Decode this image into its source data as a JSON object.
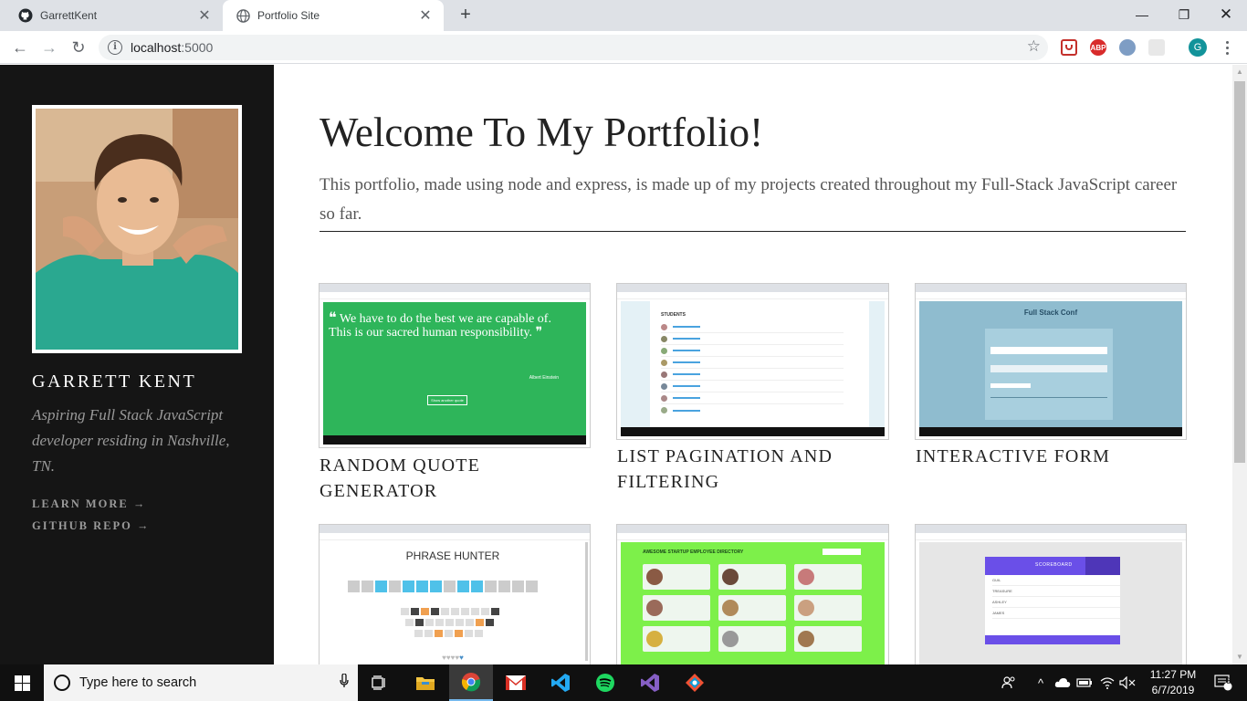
{
  "browser": {
    "tabs": [
      {
        "title": "GarrettKent",
        "active": false
      },
      {
        "title": "Portfolio Site",
        "active": true
      }
    ],
    "address": {
      "host": "localhost",
      "port": ":5000"
    },
    "profile_initial": "G",
    "extensions": [
      "ABP"
    ]
  },
  "sidebar": {
    "name": "GARRETT KENT",
    "tagline": "Aspiring Full Stack JavaScript developer residing in Nashville, TN.",
    "links": [
      {
        "label": "LEARN MORE →"
      },
      {
        "label": "GITHUB REPO →"
      }
    ]
  },
  "main": {
    "heading": "Welcome To My Portfolio!",
    "intro": "This portfolio, made using node and express, is made up of my projects created throughout my Full-Stack JavaScript career so far.",
    "projects": [
      {
        "title": "RANDOM QUOTE GENERATOR",
        "thumb_quote": "We have to do the best we are capable of. This is our sacred human responsibility.",
        "thumb_author": "Albert Einstein",
        "thumb_button": "Show another quote",
        "thumb_color": "#2eb55a"
      },
      {
        "title": "LIST PAGINATION AND FILTERING",
        "thumb_header": "STUDENTS"
      },
      {
        "title": "INTERACTIVE FORM",
        "thumb_header": "Full Stack Conf",
        "thumb_color": "#8fbccf"
      },
      {
        "title": "",
        "thumb_header": "PHRASE HUNTER"
      },
      {
        "title": "",
        "thumb_header": "AWESOME STARTUP EMPLOYEE DIRECTORY",
        "thumb_color": "#7df04a"
      },
      {
        "title": "",
        "thumb_header": "SCOREBOARD",
        "thumb_players": [
          "GUIL",
          "TREASURE",
          "ASHLEY",
          "JAMES"
        ],
        "thumb_color": "#6a4fe8"
      }
    ]
  },
  "taskbar": {
    "search_placeholder": "Type here to search",
    "time": "11:27 PM",
    "date": "6/7/2019",
    "notification_count": "6"
  }
}
